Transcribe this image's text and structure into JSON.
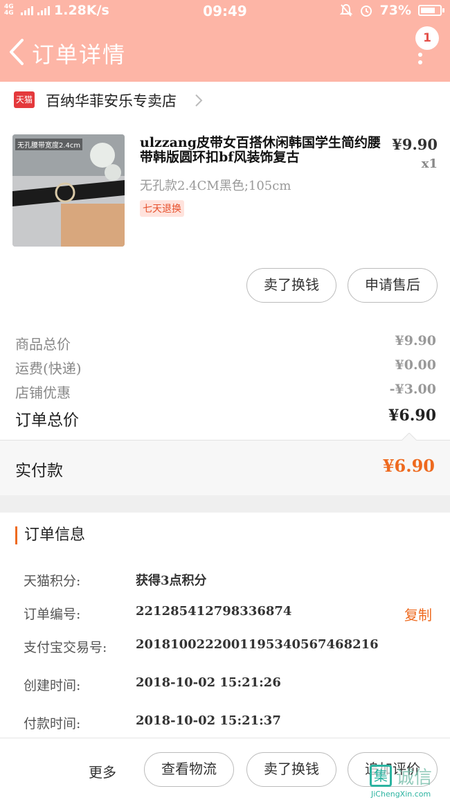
{
  "status_bar": {
    "network": "4G 4G",
    "speed": "1.28K/s",
    "time": "09:49",
    "battery": "73%",
    "icons": [
      "bell-off-icon",
      "alarm-icon",
      "battery-icon"
    ]
  },
  "header": {
    "title": "订单详情",
    "badge": "1",
    "colors": {
      "bar": "#fdb5a6"
    }
  },
  "shop": {
    "badge": "天猫",
    "name": "百纳华菲安乐专卖店"
  },
  "product": {
    "image_caption": "无孔腰带宽度2.4cm",
    "title": "ulzzang皮带女百搭休闲韩国学生简约腰带韩版圆环扣bf风装饰复古",
    "sku": "无孔款2.4CM黑色;105cm",
    "tag": "七天退换",
    "price": "¥9.90",
    "qty": "x1",
    "buttons": [
      "卖了换钱",
      "申请售后"
    ]
  },
  "summary": {
    "rows": [
      {
        "label": "商品总价",
        "value": "¥9.90"
      },
      {
        "label": "运费(快递)",
        "value": "¥0.00"
      },
      {
        "label": "店铺优惠",
        "value": "-¥3.00"
      }
    ],
    "total_label": "订单总价",
    "total_value": "¥6.90",
    "paid_label": "实付款",
    "paid_value": "¥6.90",
    "accent": "#ee6a1f"
  },
  "order_info": {
    "title": "订单信息",
    "rows": [
      {
        "label": "天猫积分:",
        "value": "获得3点积分"
      },
      {
        "label": "订单编号:",
        "value": "221285412798336874"
      },
      {
        "label": "支付宝交易号:",
        "value": "2018100222001195340567468216"
      },
      {
        "label": "创建时间:",
        "value": "2018-10-02 15:21:26"
      },
      {
        "label": "付款时间:",
        "value": "2018-10-02 15:21:37"
      }
    ],
    "copy_label": "复制"
  },
  "bottom_bar": {
    "more": "更多",
    "buttons": [
      "查看物流",
      "卖了换钱",
      "追加评价"
    ]
  },
  "watermark": {
    "logo": "集",
    "cn": "诚信",
    "en": "JiChengXin.com"
  }
}
